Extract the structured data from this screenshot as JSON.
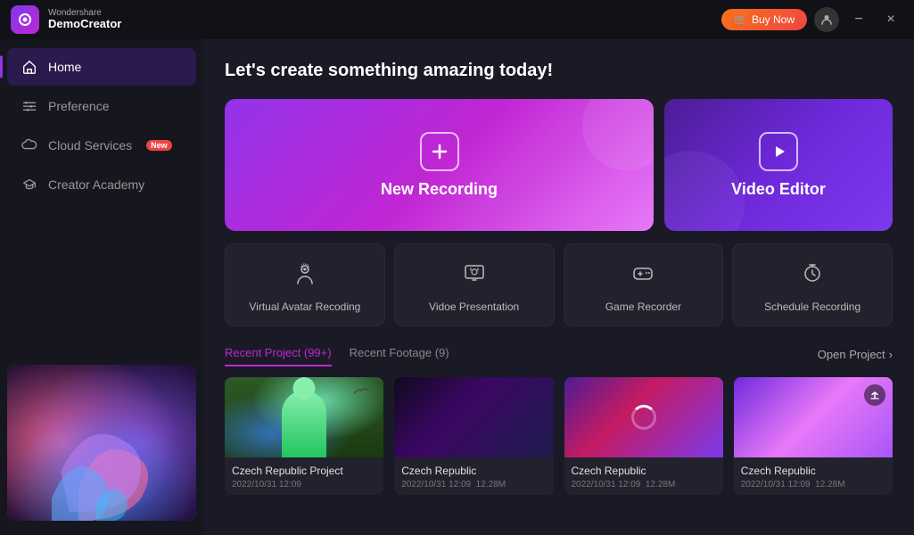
{
  "titlebar": {
    "brand_sub": "Wondershare",
    "brand_main": "DemoCreator",
    "buy_now_label": "Buy Now",
    "minimize_label": "−",
    "close_label": "×"
  },
  "sidebar": {
    "items": [
      {
        "id": "home",
        "label": "Home",
        "active": true
      },
      {
        "id": "preference",
        "label": "Preference",
        "active": false
      },
      {
        "id": "cloud-services",
        "label": "Cloud Services",
        "badge": "New",
        "active": false
      },
      {
        "id": "creator-academy",
        "label": "Creator Academy",
        "active": false
      }
    ]
  },
  "main": {
    "heading": "Let's create something amazing today!",
    "cards": {
      "new_recording": "New Recording",
      "video_editor": "Video Editor"
    },
    "secondary_cards": [
      {
        "id": "virtual-avatar",
        "label": "Virtual Avatar Recoding"
      },
      {
        "id": "video-presentation",
        "label": "Vidoe Presentation"
      },
      {
        "id": "game-recorder",
        "label": "Game Recorder"
      },
      {
        "id": "schedule-recording",
        "label": "Schedule Recording"
      }
    ],
    "recent": {
      "tabs": [
        {
          "id": "recent-project",
          "label": "Recent Project (99+)",
          "active": true
        },
        {
          "id": "recent-footage",
          "label": "Recent Footage (9)",
          "active": false
        }
      ],
      "open_project": "Open Project",
      "projects": [
        {
          "id": 1,
          "name": "Czech Republic Project",
          "date": "2022/10/31 12:09",
          "size": ""
        },
        {
          "id": 2,
          "name": "Czech Republic",
          "date": "2022/10/31 12:09",
          "size": "12.28M"
        },
        {
          "id": 3,
          "name": "Czech Republic",
          "date": "2022/10/31 12:09",
          "size": "12.28M"
        },
        {
          "id": 4,
          "name": "Czech Republic",
          "date": "2022/10/31 12:09",
          "size": "12.28M"
        }
      ]
    }
  }
}
